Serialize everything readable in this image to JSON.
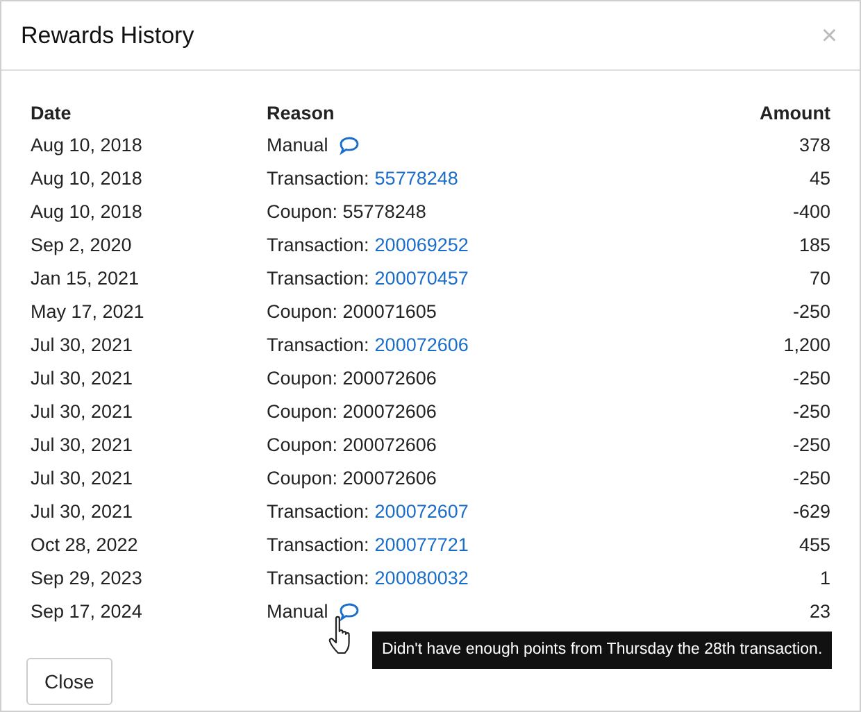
{
  "dialog": {
    "title": "Rewards History",
    "close": "×"
  },
  "table": {
    "columns": [
      "Date",
      "Reason",
      "Amount"
    ],
    "rows": [
      {
        "date": "Aug 10, 2018",
        "reason": {
          "kind": "manual",
          "text": "Manual"
        },
        "amount": "378"
      },
      {
        "date": "Aug 10, 2018",
        "reason": {
          "kind": "transaction",
          "text": "Transaction:",
          "link": "55778248"
        },
        "amount": "45"
      },
      {
        "date": "Aug 10, 2018",
        "reason": {
          "kind": "coupon",
          "text": "Coupon: 55778248"
        },
        "amount": "-400"
      },
      {
        "date": "Sep 2, 2020",
        "reason": {
          "kind": "transaction",
          "text": "Transaction:",
          "link": "200069252"
        },
        "amount": "185"
      },
      {
        "date": "Jan 15, 2021",
        "reason": {
          "kind": "transaction",
          "text": "Transaction:",
          "link": "200070457"
        },
        "amount": "70"
      },
      {
        "date": "May 17, 2021",
        "reason": {
          "kind": "coupon",
          "text": "Coupon: 200071605"
        },
        "amount": "-250"
      },
      {
        "date": "Jul 30, 2021",
        "reason": {
          "kind": "transaction",
          "text": "Transaction:",
          "link": "200072606"
        },
        "amount": "1,200"
      },
      {
        "date": "Jul 30, 2021",
        "reason": {
          "kind": "coupon",
          "text": "Coupon: 200072606"
        },
        "amount": "-250"
      },
      {
        "date": "Jul 30, 2021",
        "reason": {
          "kind": "coupon",
          "text": "Coupon: 200072606"
        },
        "amount": "-250"
      },
      {
        "date": "Jul 30, 2021",
        "reason": {
          "kind": "coupon",
          "text": "Coupon: 200072606"
        },
        "amount": "-250"
      },
      {
        "date": "Jul 30, 2021",
        "reason": {
          "kind": "coupon",
          "text": "Coupon: 200072606"
        },
        "amount": "-250"
      },
      {
        "date": "Jul 30, 2021",
        "reason": {
          "kind": "transaction",
          "text": "Transaction:",
          "link": "200072607"
        },
        "amount": "-629"
      },
      {
        "date": "Oct 28, 2022",
        "reason": {
          "kind": "transaction",
          "text": "Transaction:",
          "link": "200077721"
        },
        "amount": "455"
      },
      {
        "date": "Sep 29, 2023",
        "reason": {
          "kind": "transaction",
          "text": "Transaction:",
          "link": "200080032"
        },
        "amount": "1"
      },
      {
        "date": "Sep 17, 2024",
        "reason": {
          "kind": "manual",
          "text": "Manual",
          "tooltip": "Didn't have enough points from Thursday the 28th transaction."
        },
        "amount": "23"
      }
    ]
  },
  "footer": {
    "button": "Close"
  }
}
